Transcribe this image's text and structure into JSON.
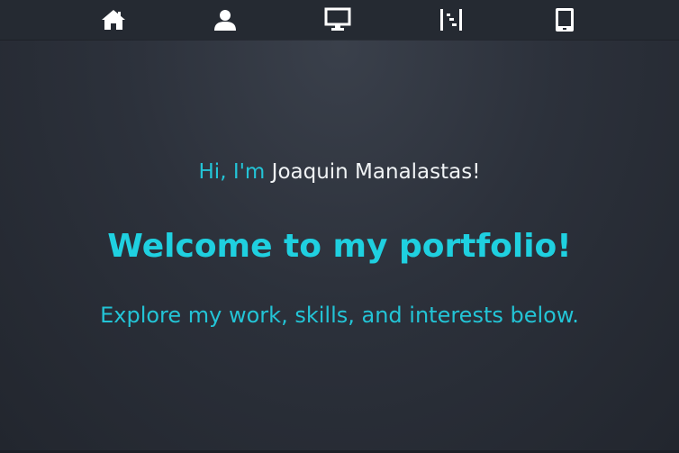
{
  "nav": {
    "items": [
      {
        "icon": "home-icon"
      },
      {
        "icon": "user-icon"
      },
      {
        "icon": "desktop-icon"
      },
      {
        "icon": "tasks-icon"
      },
      {
        "icon": "tablet-icon"
      }
    ]
  },
  "hero": {
    "greeting_prefix": "Hi, I'm ",
    "name": "Joaquin Manalastas",
    "greeting_suffix": "!",
    "welcome": "Welcome to my portfolio!",
    "explore": "Explore my work, skills, and interests below."
  },
  "colors": {
    "accent": "#1fd0e0",
    "nav_background": "#252a32",
    "background": "#2c313b",
    "name_text": "#f0f3f5"
  }
}
